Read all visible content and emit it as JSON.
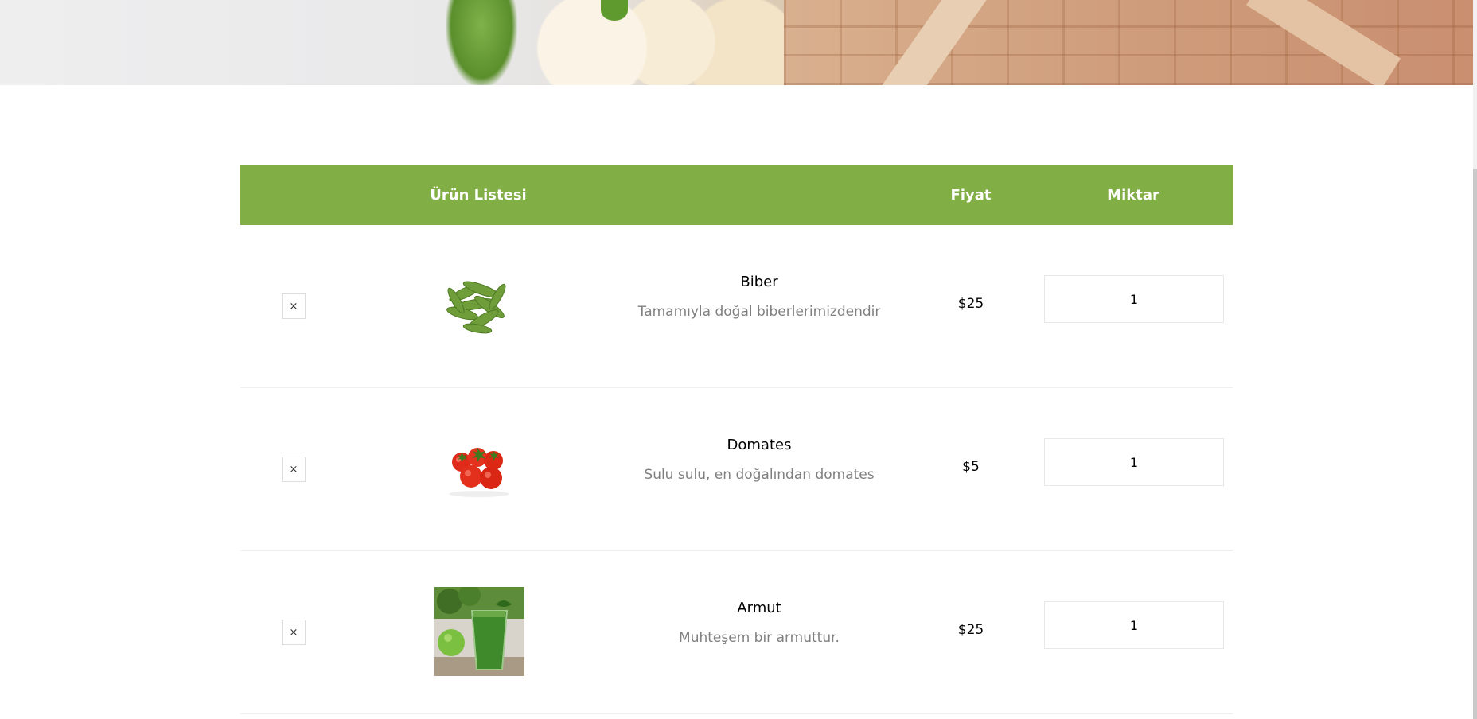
{
  "table": {
    "headers": {
      "product": "Ürün Listesi",
      "price": "Fiyat",
      "quantity": "Miktar"
    },
    "remove_label": "×",
    "rows": [
      {
        "name": "Biber",
        "description": "Tamamıyla doğal biberlerimizdendir",
        "price": "$25",
        "quantity": "1"
      },
      {
        "name": "Domates",
        "description": "Sulu sulu, en doğalından domates",
        "price": "$5",
        "quantity": "1"
      },
      {
        "name": "Armut",
        "description": "Muhteşem bir armuttur.",
        "price": "$25",
        "quantity": "1"
      }
    ]
  },
  "colors": {
    "header_bg": "#82ae46",
    "header_text": "#ffffff",
    "description_text": "#808080"
  }
}
